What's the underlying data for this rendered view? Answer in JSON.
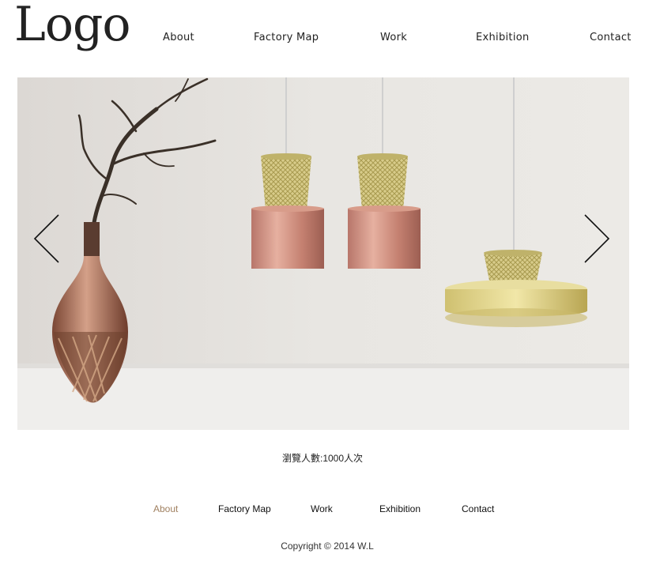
{
  "header": {
    "logo": "Logo",
    "nav": [
      "About",
      "Factory Map",
      "Work",
      "Exhibition",
      "Contact"
    ]
  },
  "hero": {
    "prev_icon": "chevron-left-icon",
    "next_icon": "chevron-right-icon"
  },
  "visitor_counter": "瀏覽人數:1000人次",
  "footer": {
    "nav": [
      "About",
      "Factory Map",
      "Work",
      "Exhibition",
      "Contact"
    ],
    "active_item": "About",
    "active_color": "#a08060",
    "copyright": "Copyright © 2014  W.L"
  }
}
